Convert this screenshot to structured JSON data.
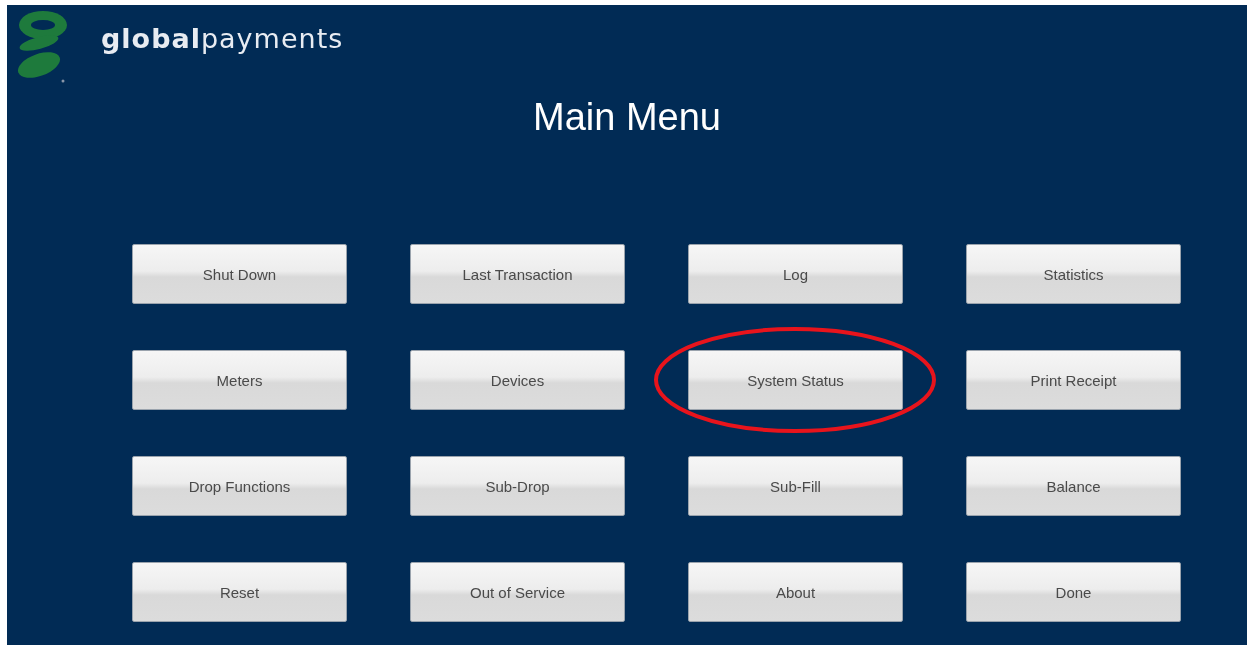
{
  "logo": {
    "text": "**global**payments"
  },
  "title": "Main Menu",
  "buttons": [
    {
      "label": "Shut Down",
      "circled": false
    },
    {
      "label": "Last Transaction",
      "circled": false
    },
    {
      "label": "Log",
      "circled": false
    },
    {
      "label": "Statistics",
      "circled": false
    },
    {
      "label": "Meters",
      "circled": false
    },
    {
      "label": "Devices",
      "circled": false
    },
    {
      "label": "System Status",
      "circled": true
    },
    {
      "label": "Print Receipt",
      "circled": false
    },
    {
      "label": "Drop Functions",
      "circled": false
    },
    {
      "label": "Sub-Drop",
      "circled": false
    },
    {
      "label": "Sub-Fill",
      "circled": false
    },
    {
      "label": "Balance",
      "circled": false
    },
    {
      "label": "Reset",
      "circled": false
    },
    {
      "label": "Out of Service",
      "circled": false
    },
    {
      "label": "About",
      "circled": false
    },
    {
      "label": "Done",
      "circled": false
    }
  ]
}
